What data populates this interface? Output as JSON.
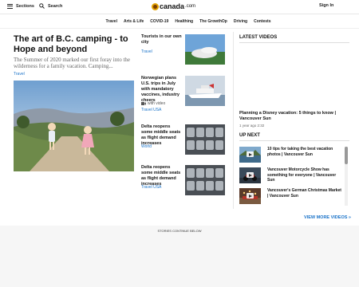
{
  "topbar": {
    "sections_label": "Sections",
    "search_label": "Search",
    "signin_label": "Sign In",
    "logo_text": "canada",
    "logo_domain": ".com"
  },
  "nav": {
    "items": [
      "Travel",
      "Arts & Life",
      "COVID-19",
      "Healthing",
      "The GrowthOp",
      "Driving",
      "Contests"
    ]
  },
  "hero": {
    "title": "The art of B.C. camping - to Hope and beyond",
    "description": "The Summer of 2020 marked our first foray into the wilderness for a family vacation. Camping...",
    "category": "Travel"
  },
  "stories": [
    {
      "title": "Tourists in our own city",
      "category": "Travel",
      "meta": ""
    },
    {
      "title": "Norwegian plans U.S. trips in July with mandatory vaccines, industry cheers",
      "category": "Travel USA",
      "meta": "with video"
    },
    {
      "title": "Delta reopens some middle seats as flight demand increases",
      "category": "World",
      "meta": ""
    },
    {
      "title": "Delta reopens some middle seats as flight demand increases",
      "category": "Travel USA",
      "meta": ""
    }
  ],
  "latest_videos": {
    "heading": "LATEST VIDEOS",
    "featured_title": "Planning a Disney vacation: 5 things to know | Vancouver Sun",
    "featured_meta": "1 year ago   2:32"
  },
  "up_next": {
    "heading": "UP NEXT",
    "items": [
      {
        "title": "10 tips for taking the best vacation photos | Vancouver Sun"
      },
      {
        "title": "Vancouver Motorcycle Show has something for everyone | Vancouver Sun"
      },
      {
        "title": "Vancouver's German Christmas Market | Vancouver Sun"
      }
    ],
    "view_more_label": "VIEW MORE VIDEOS »"
  },
  "footer": {
    "continue_label": "STORIES CONTINUE BELOW"
  },
  "colors": {
    "link_blue": "#1a73c9",
    "logo_gold": "#e2a100"
  }
}
